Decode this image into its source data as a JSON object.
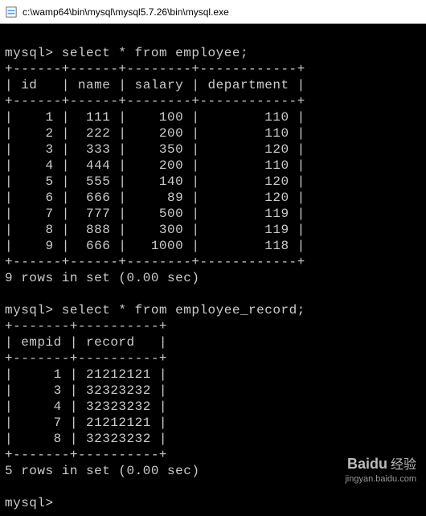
{
  "window": {
    "title": "c:\\wamp64\\bin\\mysql\\mysql5.7.26\\bin\\mysql.exe"
  },
  "prompt": "mysql>",
  "queries": {
    "q1": {
      "sql": "select * from employee;",
      "border_top": "+------+------+--------+------------+",
      "header_line": "| id   | name | salary | department |",
      "border_mid": "+------+------+--------+------------+",
      "rows": [
        "|    1 |  111 |    100 |        110 |",
        "|    2 |  222 |    200 |        110 |",
        "|    3 |  333 |    350 |        120 |",
        "|    4 |  444 |    200 |        110 |",
        "|    5 |  555 |    140 |        120 |",
        "|    6 |  666 |     89 |        120 |",
        "|    7 |  777 |    500 |        119 |",
        "|    8 |  888 |    300 |        119 |",
        "|    9 |  666 |   1000 |        118 |"
      ],
      "border_bot": "+------+------+--------+------------+",
      "status": "9 rows in set (0.00 sec)",
      "data": [
        {
          "id": 1,
          "name": 111,
          "salary": 100,
          "department": 110
        },
        {
          "id": 2,
          "name": 222,
          "salary": 200,
          "department": 110
        },
        {
          "id": 3,
          "name": 333,
          "salary": 350,
          "department": 120
        },
        {
          "id": 4,
          "name": 444,
          "salary": 200,
          "department": 110
        },
        {
          "id": 5,
          "name": 555,
          "salary": 140,
          "department": 120
        },
        {
          "id": 6,
          "name": 666,
          "salary": 89,
          "department": 120
        },
        {
          "id": 7,
          "name": 777,
          "salary": 500,
          "department": 119
        },
        {
          "id": 8,
          "name": 888,
          "salary": 300,
          "department": 119
        },
        {
          "id": 9,
          "name": 666,
          "salary": 1000,
          "department": 118
        }
      ]
    },
    "q2": {
      "sql": "select * from employee_record;",
      "border_top": "+-------+----------+",
      "header_line": "| empid | record   |",
      "border_mid": "+-------+----------+",
      "rows": [
        "|     1 | 21212121 |",
        "|     3 | 32323232 |",
        "|     4 | 32323232 |",
        "|     7 | 21212121 |",
        "|     8 | 32323232 |"
      ],
      "border_bot": "+-------+----------+",
      "status": "5 rows in set (0.00 sec)",
      "data": [
        {
          "empid": 1,
          "record": 21212121
        },
        {
          "empid": 3,
          "record": 32323232
        },
        {
          "empid": 4,
          "record": 32323232
        },
        {
          "empid": 7,
          "record": 21212121
        },
        {
          "empid": 8,
          "record": 32323232
        }
      ]
    }
  },
  "watermark": {
    "brand_pre": "Bai",
    "brand_accent": "d",
    "brand_post": "u",
    "sub": "经验",
    "url": "jingyan.baidu.com"
  }
}
